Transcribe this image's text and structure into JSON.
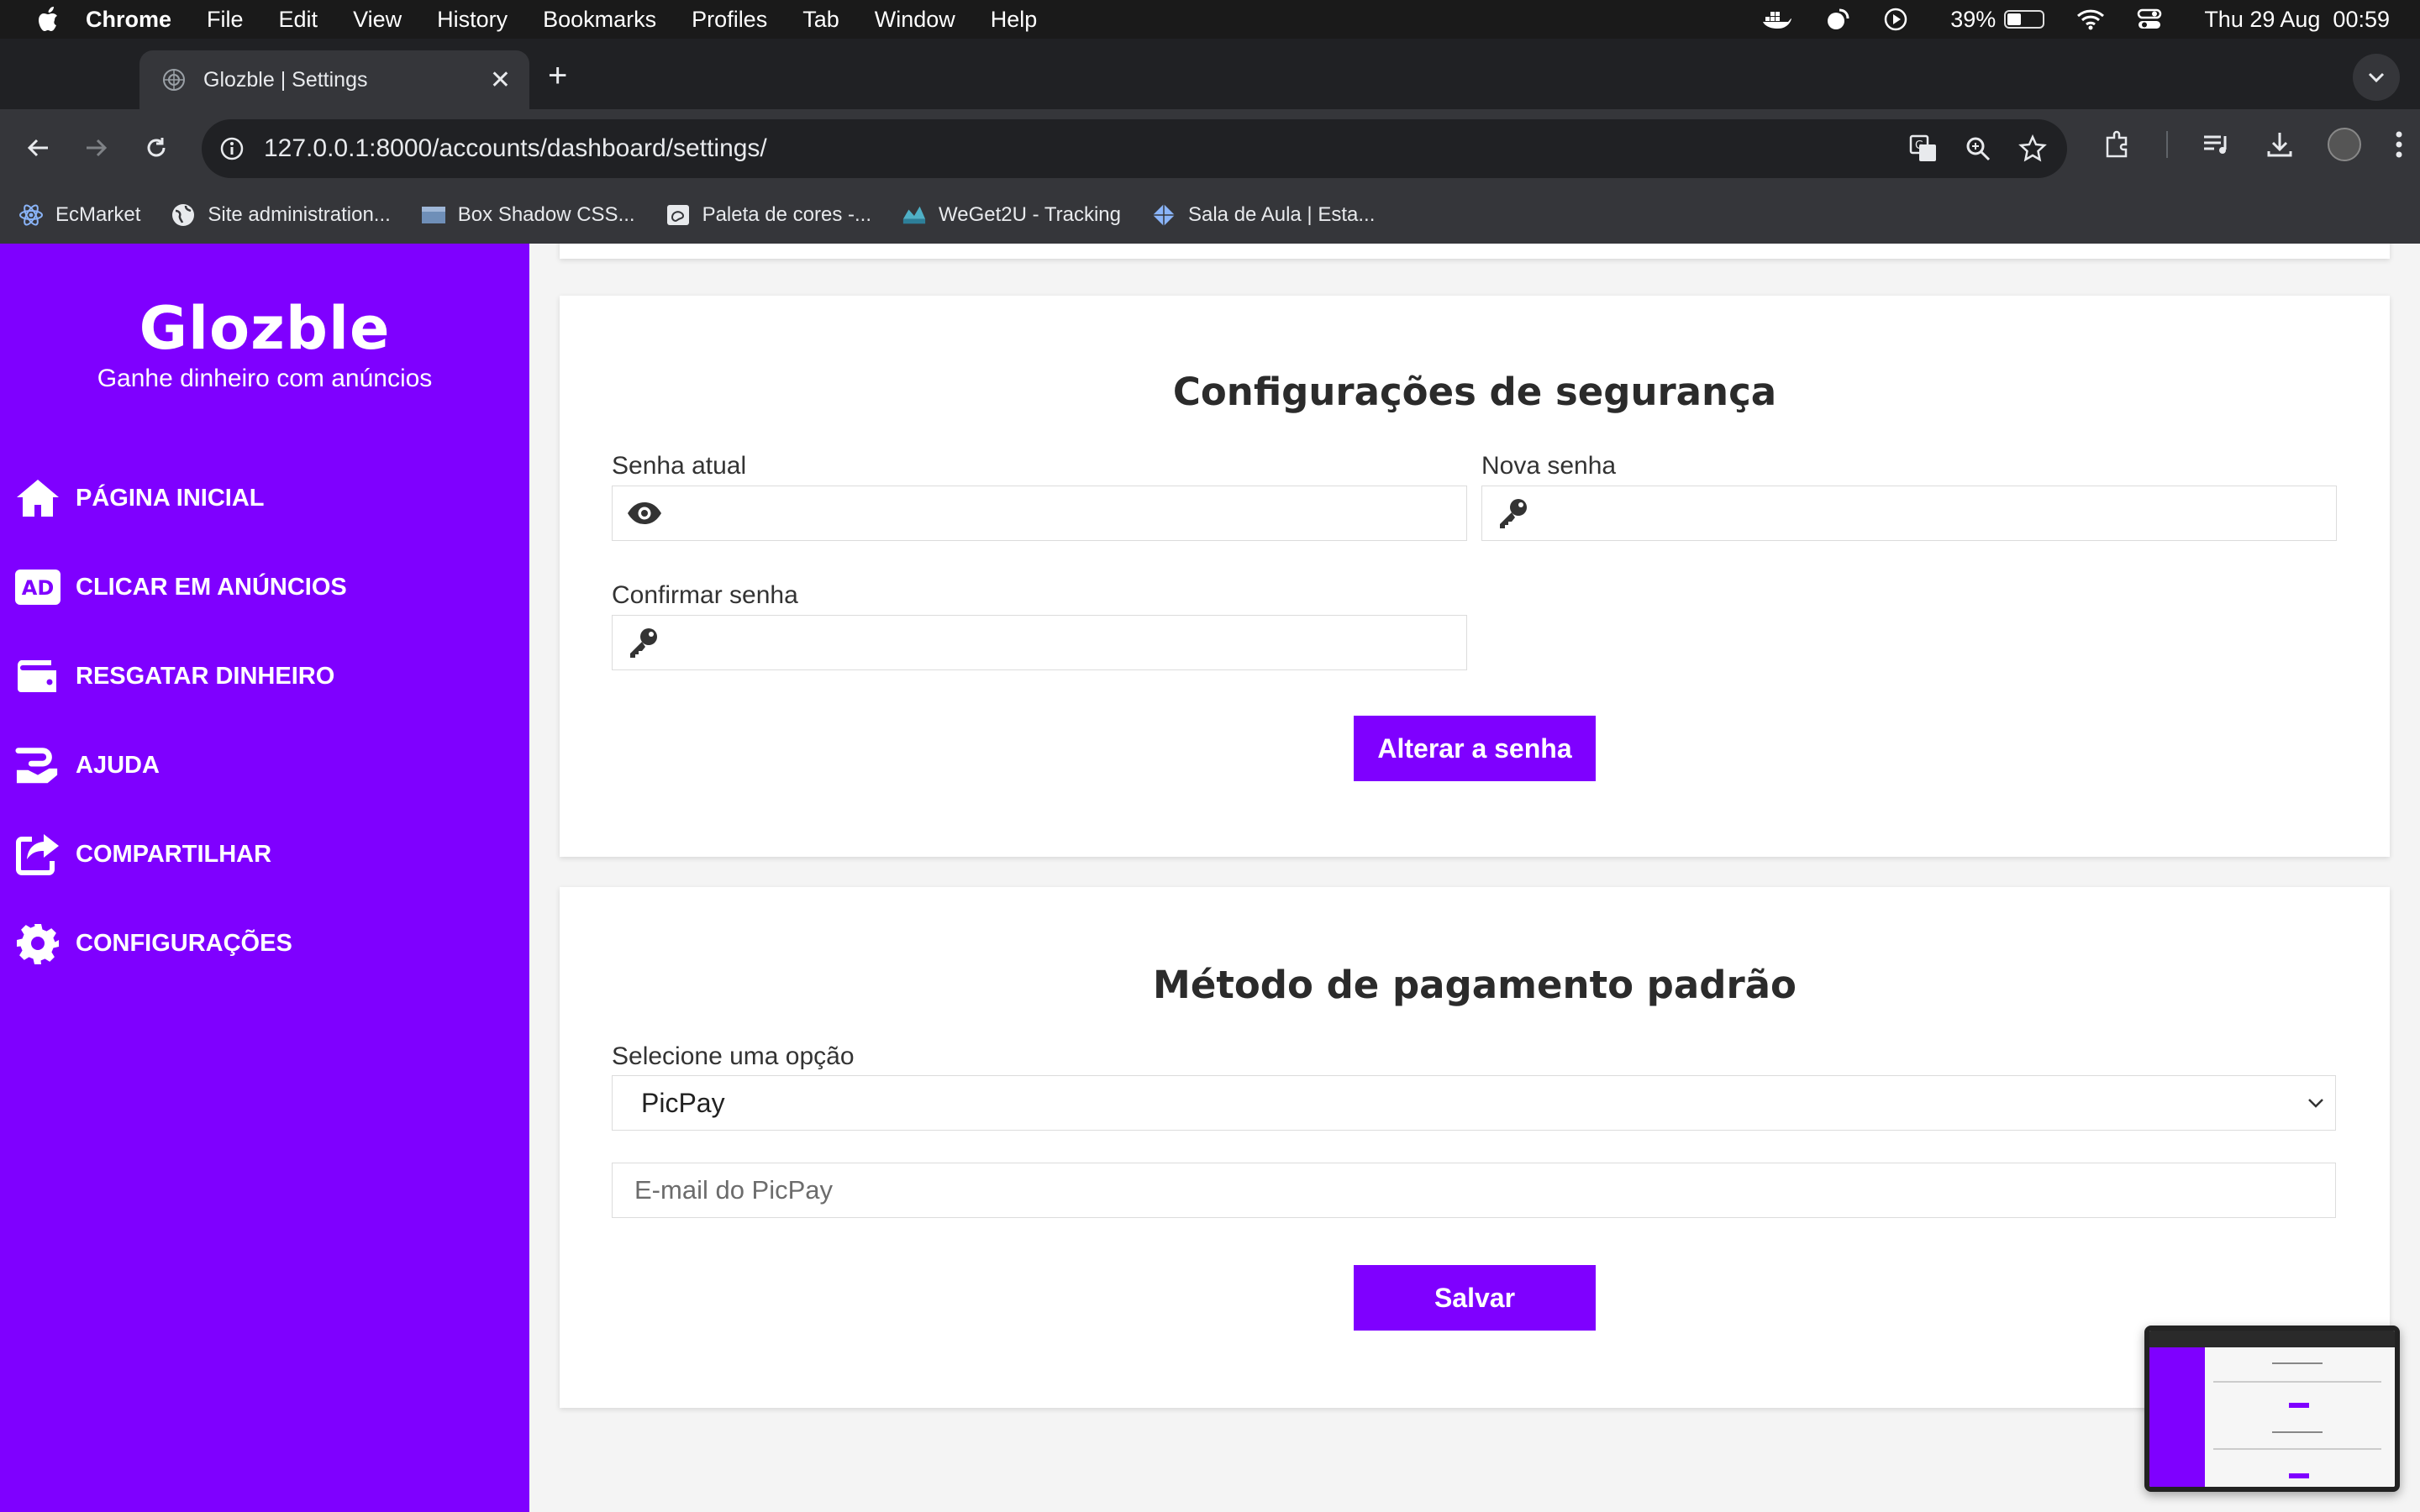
{
  "menubar": {
    "app": "Chrome",
    "menus": [
      "File",
      "Edit",
      "View",
      "History",
      "Bookmarks",
      "Profiles",
      "Tab",
      "Window",
      "Help"
    ],
    "battery": "39%",
    "battery_level": 0.39,
    "datetime": "Thu 29 Aug  00:59"
  },
  "browser": {
    "tab_title": "Glozble | Settings",
    "url": "127.0.0.1:8000/accounts/dashboard/settings/",
    "bookmarks": [
      {
        "label": "EcMarket",
        "icon": "react-icon"
      },
      {
        "label": "Site administration...",
        "icon": "globe-icon"
      },
      {
        "label": "Box Shadow CSS...",
        "icon": "image-icon"
      },
      {
        "label": "Paleta de cores -...",
        "icon": "palette-icon"
      },
      {
        "label": "WeGet2U - Tracking",
        "icon": "tracking-icon"
      },
      {
        "label": "Sala de Aula | Esta...",
        "icon": "diamond-icon"
      }
    ]
  },
  "sidebar": {
    "logo": "Glozble",
    "tagline": "Ganhe dinheiro com anúncios",
    "badge_ad": "AD",
    "items": [
      {
        "label": "PÁGINA INICIAL",
        "icon": "home-icon"
      },
      {
        "label": "CLICAR EM ANÚNCIOS",
        "icon": "ad-icon"
      },
      {
        "label": "RESGATAR DINHEIRO",
        "icon": "wallet-icon"
      },
      {
        "label": "AJUDA",
        "icon": "help-hand-icon"
      },
      {
        "label": "COMPARTILHAR",
        "icon": "share-icon"
      },
      {
        "label": "CONFIGURAÇÕES",
        "icon": "gear-icon"
      }
    ]
  },
  "security": {
    "title": "Configurações de segurança",
    "current_password_label": "Senha atual",
    "new_password_label": "Nova senha",
    "confirm_password_label": "Confirmar senha",
    "submit_label": "Alterar a senha"
  },
  "payment": {
    "title": "Método de pagamento padrão",
    "select_label": "Selecione uma opção",
    "selected_option": "PicPay",
    "email_placeholder": "E-mail do PicPay",
    "submit_label": "Salvar"
  },
  "colors": {
    "brand": "#7f00ff",
    "menubar": "#1a1a1a",
    "chrome_toolbar": "#35363a"
  }
}
